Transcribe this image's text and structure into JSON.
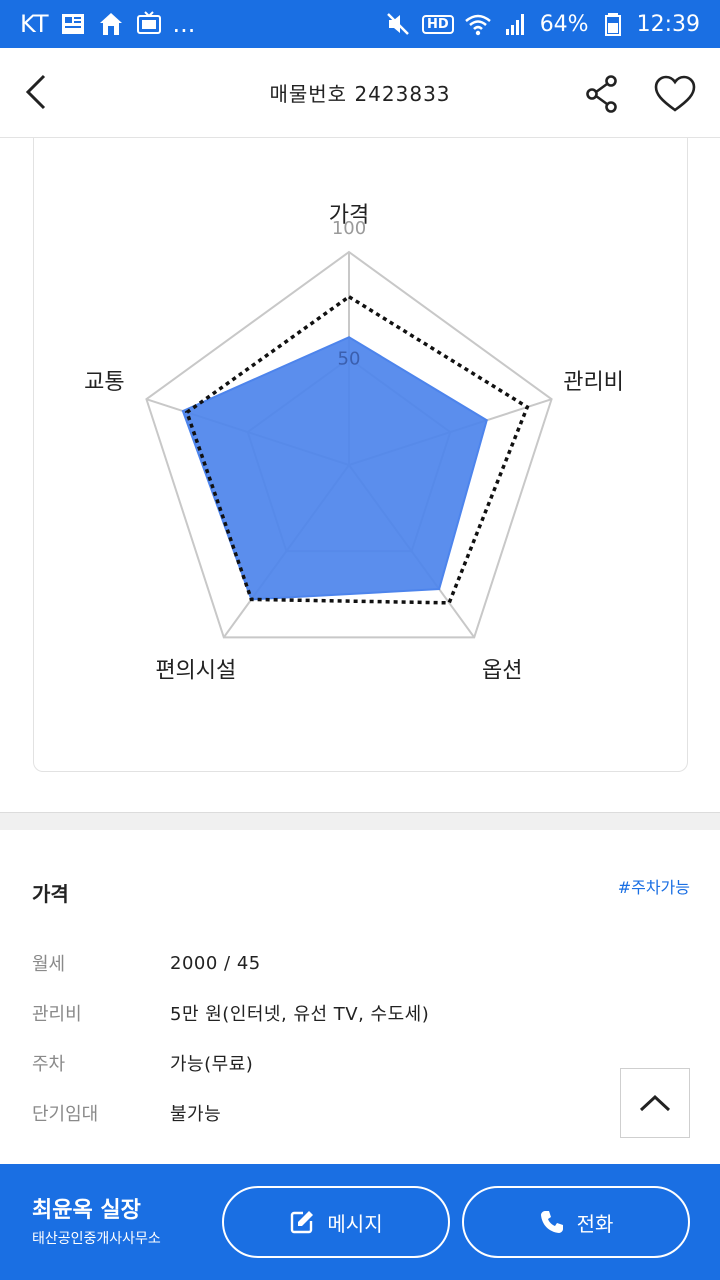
{
  "status_bar": {
    "carrier": "KT",
    "more": "...",
    "hd": "HD",
    "battery": "64%",
    "time": "12:39"
  },
  "header": {
    "title": "매물번호 2423833"
  },
  "radar": {
    "axes": [
      "가격",
      "관리비",
      "옵션",
      "편의시설",
      "교통"
    ],
    "ticks": [
      "100",
      "50"
    ],
    "max": 100,
    "property_values": [
      60,
      68,
      72,
      78,
      82
    ],
    "average_values": [
      79,
      88,
      80,
      78,
      80
    ],
    "fill_color": "#4d84ec",
    "grid_color": "#c8c8c8"
  },
  "price": {
    "title": "가격",
    "tag": "#주차가능",
    "rows": [
      {
        "label": "월세",
        "value": "2000 / 45"
      },
      {
        "label": "관리비",
        "value": "5만 원(인터넷, 유선 TV, 수도세)"
      },
      {
        "label": "주차",
        "value": "가능(무료)"
      },
      {
        "label": "단기임대",
        "value": "불가능"
      }
    ]
  },
  "bottom": {
    "agent": "최윤옥 실장",
    "agency": "태산공인중개사사무소",
    "message": "메시지",
    "call": "전화"
  },
  "colors": {
    "primary": "#1a6fe3"
  }
}
